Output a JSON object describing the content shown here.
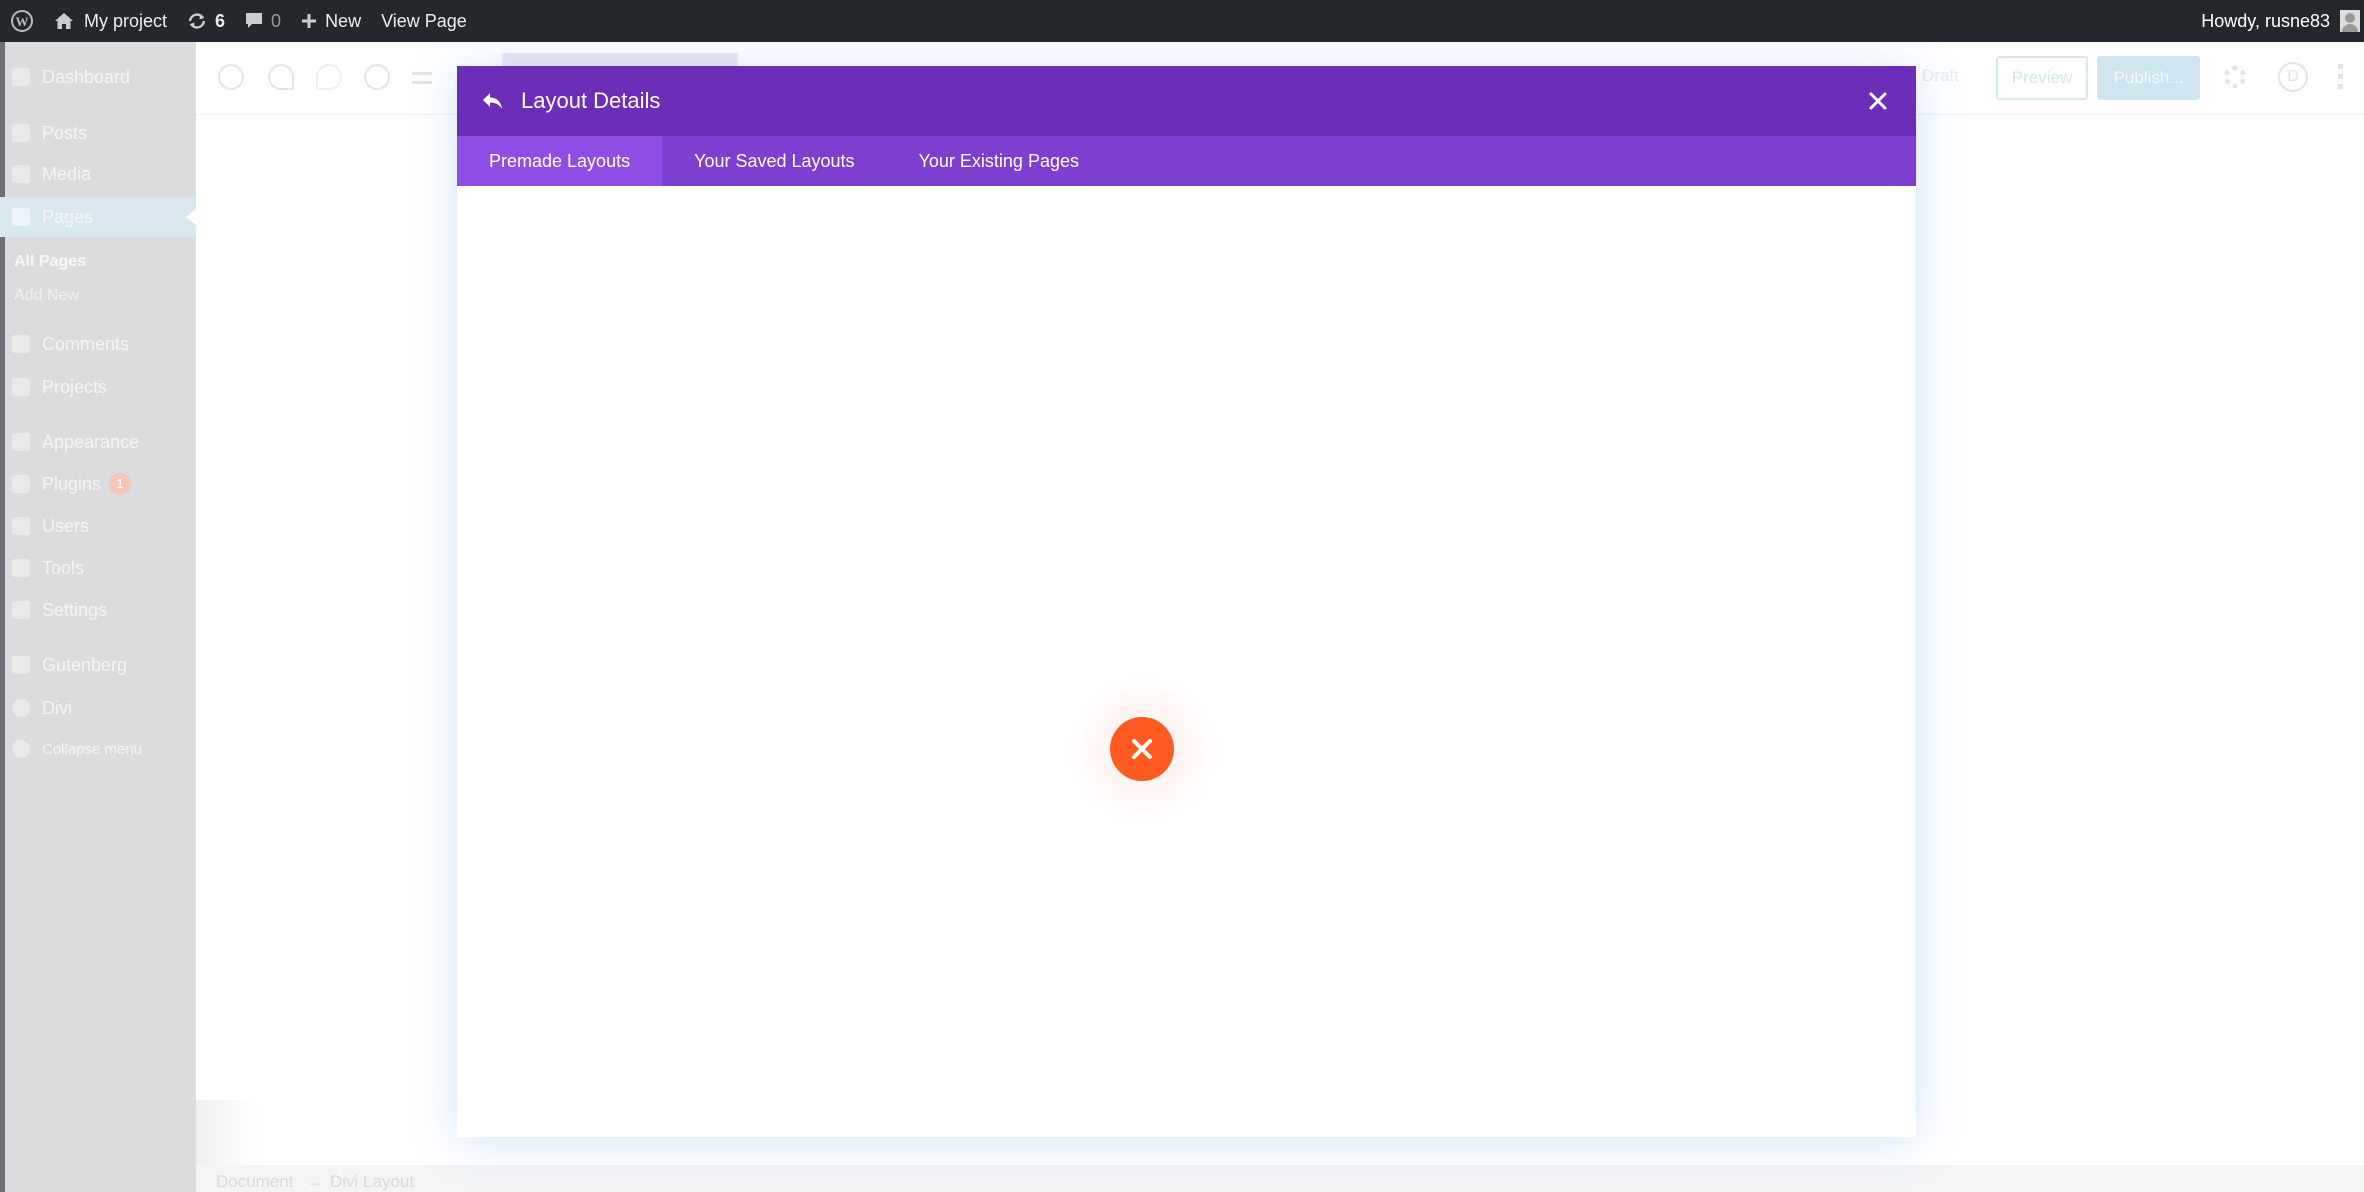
{
  "adminbar": {
    "site_name": "My project",
    "updates_count": "6",
    "comments_count": "0",
    "new_label": "New",
    "view_page_label": "View Page",
    "greeting": "Howdy, rusne83"
  },
  "sidebar": {
    "items": [
      {
        "label": "Dashboard"
      },
      {
        "label": "Posts"
      },
      {
        "label": "Media"
      },
      {
        "label": "Pages"
      },
      {
        "label": "Comments"
      },
      {
        "label": "Projects"
      },
      {
        "label": "Appearance"
      },
      {
        "label": "Plugins",
        "badge": "1"
      },
      {
        "label": "Users"
      },
      {
        "label": "Tools"
      },
      {
        "label": "Settings"
      },
      {
        "label": "Gutenberg"
      },
      {
        "label": "Divi"
      },
      {
        "label": "Collapse menu"
      }
    ],
    "submenu": {
      "all_pages": "All Pages",
      "add_new": "Add New"
    }
  },
  "editor": {
    "draft_label": "Draft",
    "preview_label": "Preview",
    "publish_label": "Publish...",
    "divi_letter": "D",
    "breadcrumb": [
      "Document",
      "→",
      "Divi Layout"
    ]
  },
  "modal": {
    "title": "Layout Details",
    "tabs": [
      {
        "label": "Premade Layouts",
        "active": true
      },
      {
        "label": "Your Saved Layouts",
        "active": false
      },
      {
        "label": "Your Existing Pages",
        "active": false
      }
    ],
    "colors": {
      "header": "#6c2eb9",
      "tabs_bar": "#7e3fd1",
      "active_tab": "#8f4de6",
      "error": "#ff5a21"
    },
    "icons": [
      "back-arrow-icon",
      "close-icon",
      "error-x-icon"
    ]
  }
}
